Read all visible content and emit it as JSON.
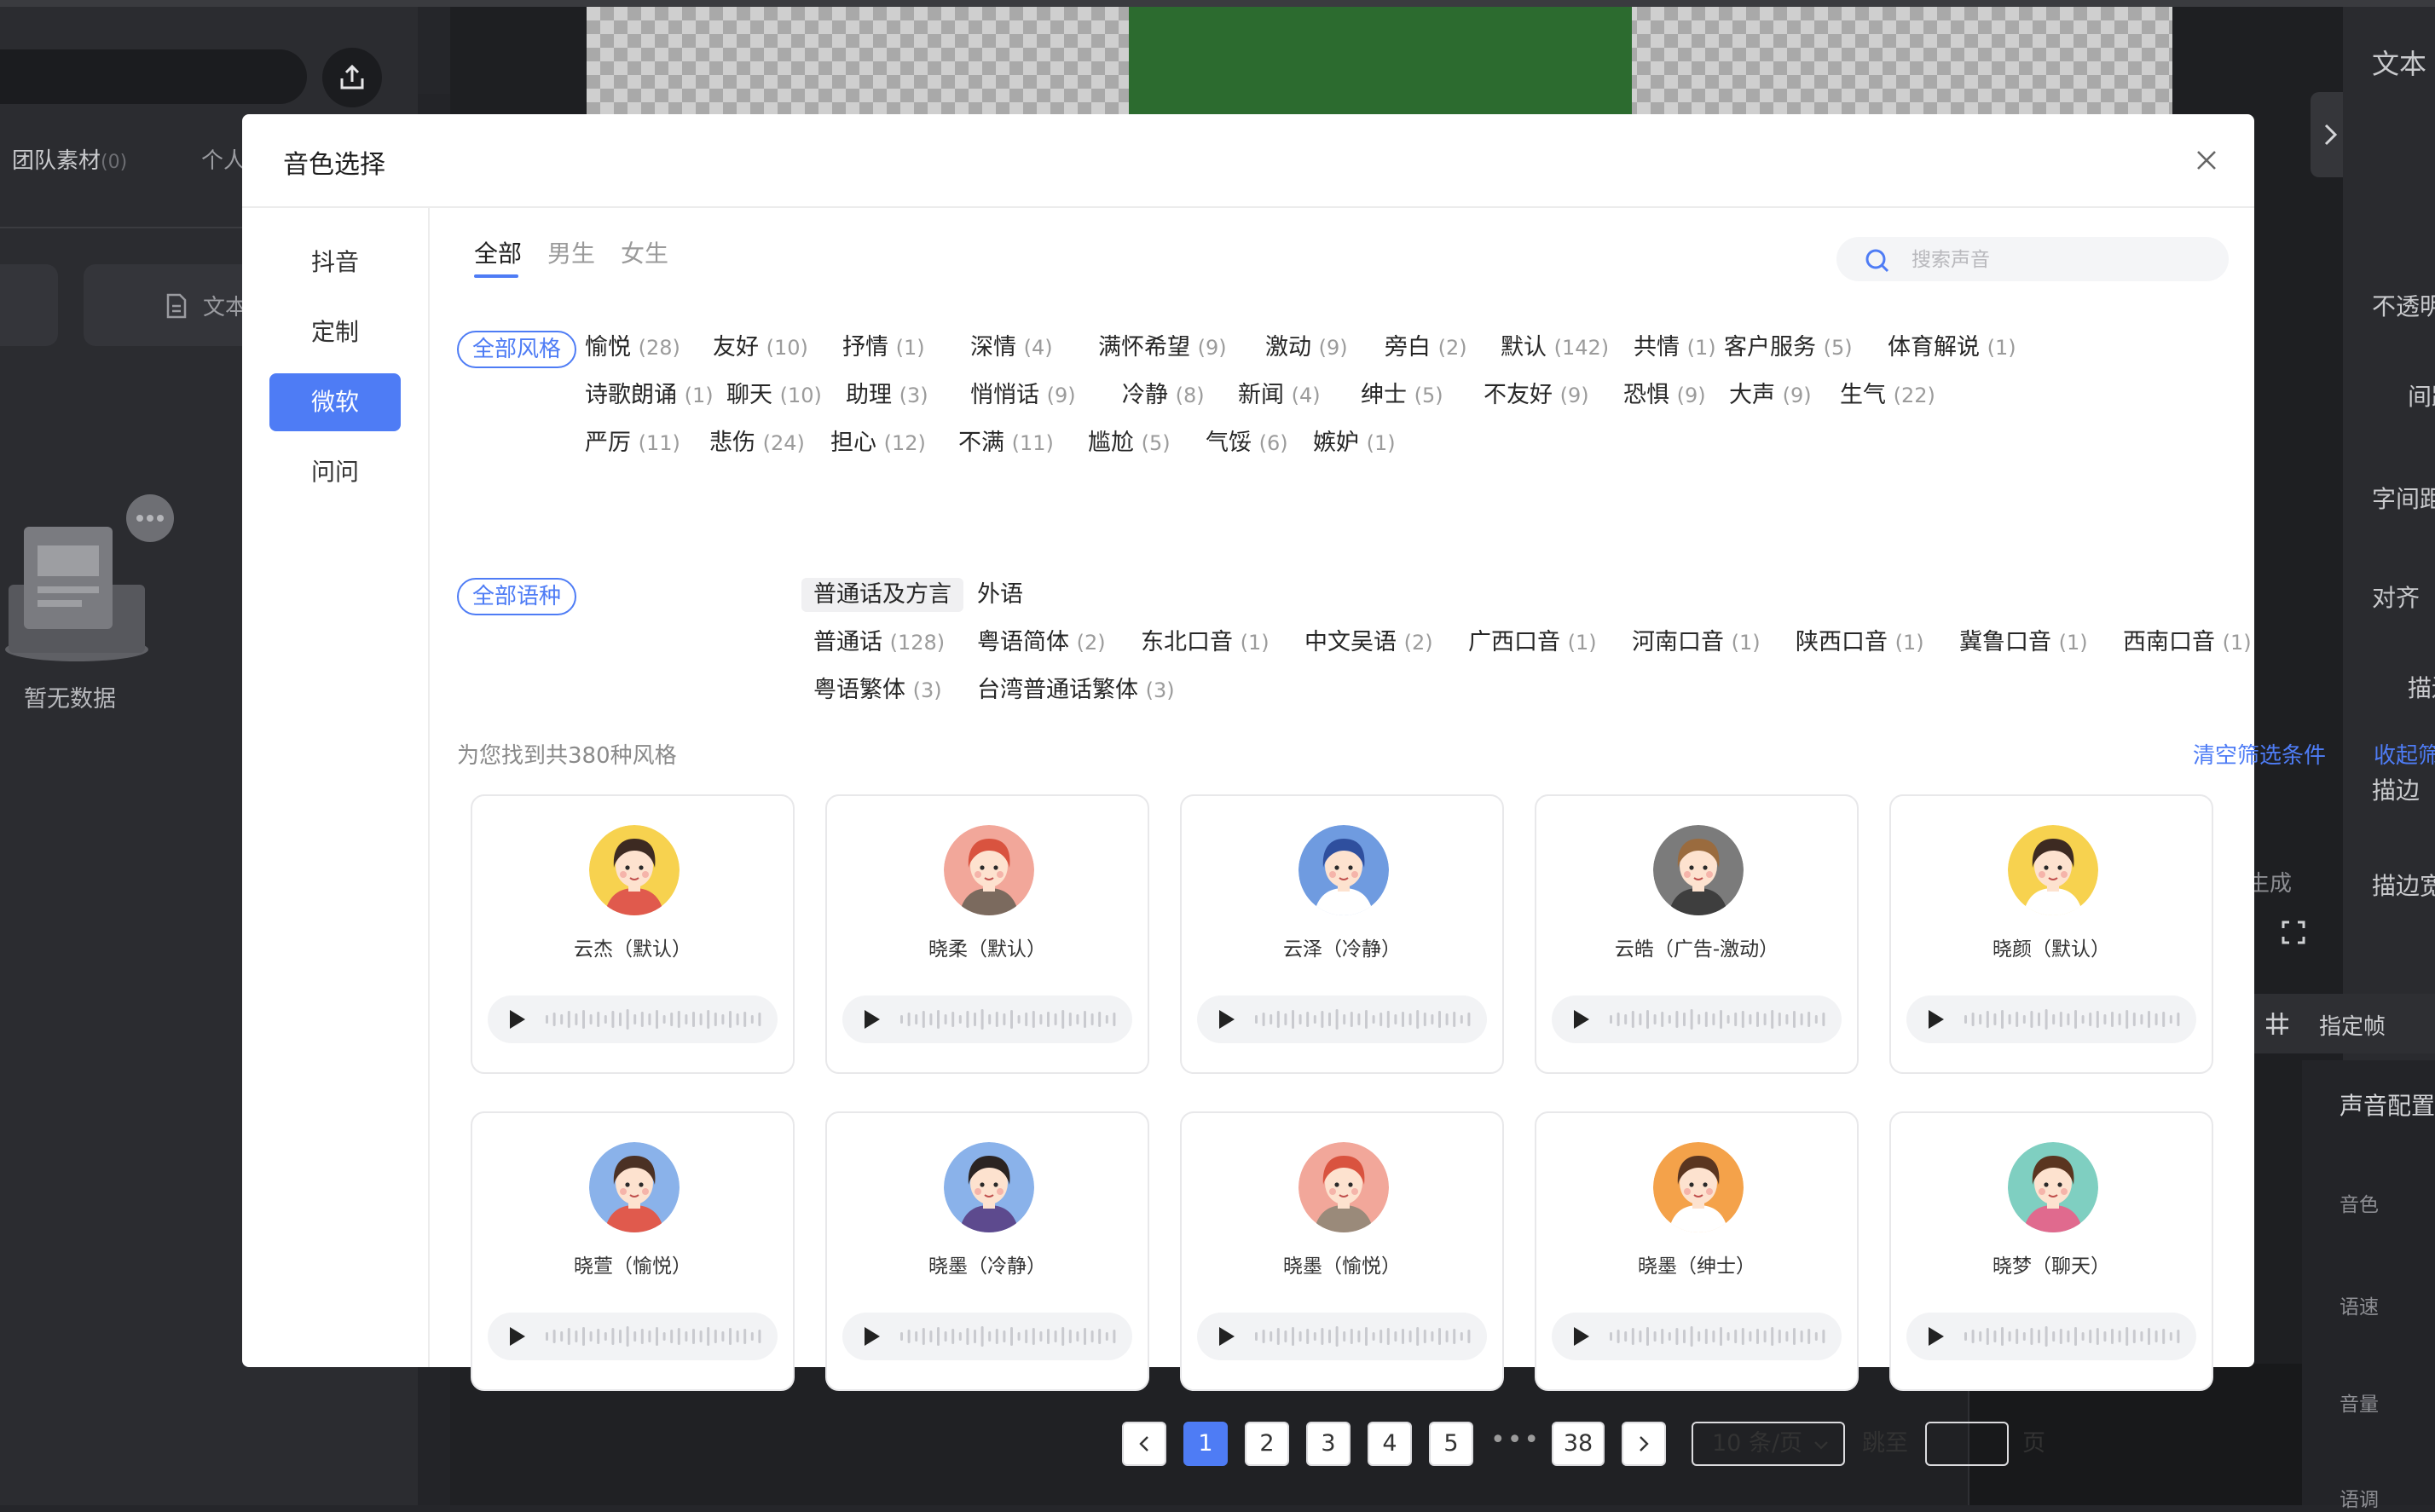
{
  "app": {
    "left_tabs": [
      "团队素材",
      "(0)",
      "个人"
    ],
    "left_chip_label": "文本",
    "empty_text": "暂无数据",
    "right_panel": [
      "文本",
      "不透明",
      "间距",
      "字间距",
      "对齐",
      "描边",
      "描边",
      "描边宽"
    ],
    "right_lower": [
      "声音配置",
      "音色",
      "语速",
      "音量",
      "语调"
    ],
    "side_hint": "生成",
    "frame_ctrl": "指定帧"
  },
  "modal": {
    "title": "音色选择",
    "sidebar": [
      "抖音",
      "定制",
      "微软",
      "问问"
    ],
    "sidebar_active": "微软",
    "gender_tabs": [
      "全部",
      "男生",
      "女生"
    ],
    "search_placeholder": "搜索声音",
    "style_filter_label": "全部风格",
    "styles": [
      {
        "name": "愉悦",
        "count": "(28)"
      },
      {
        "name": "友好",
        "count": "(10)"
      },
      {
        "name": "抒情",
        "count": "(1)"
      },
      {
        "name": "深情",
        "count": "(4)"
      },
      {
        "name": "满怀希望",
        "count": "(9)"
      },
      {
        "name": "激动",
        "count": "(9)"
      },
      {
        "name": "旁白",
        "count": "(2)"
      },
      {
        "name": "默认",
        "count": "(142)"
      },
      {
        "name": "共情",
        "count": "(1)"
      },
      {
        "name": "客户服务",
        "count": "(5)"
      },
      {
        "name": "体育解说",
        "count": "(1)"
      },
      {
        "name": "诗歌朗诵",
        "count": "(1)"
      },
      {
        "name": "聊天",
        "count": "(10)"
      },
      {
        "name": "助理",
        "count": "(3)"
      },
      {
        "name": "悄悄话",
        "count": "(9)"
      },
      {
        "name": "冷静",
        "count": "(8)"
      },
      {
        "name": "新闻",
        "count": "(4)"
      },
      {
        "name": "绅士",
        "count": "(5)"
      },
      {
        "name": "不友好",
        "count": "(9)"
      },
      {
        "name": "恐惧",
        "count": "(9)"
      },
      {
        "name": "大声",
        "count": "(9)"
      },
      {
        "name": "生气",
        "count": "(22)"
      },
      {
        "name": "严厉",
        "count": "(11)"
      },
      {
        "name": "悲伤",
        "count": "(24)"
      },
      {
        "name": "担心",
        "count": "(12)"
      },
      {
        "name": "不满",
        "count": "(11)"
      },
      {
        "name": "尴尬",
        "count": "(5)"
      },
      {
        "name": "气馁",
        "count": "(6)"
      },
      {
        "name": "嫉妒",
        "count": "(1)"
      }
    ],
    "language_filter_label": "全部语种",
    "language_groups": [
      "普通话及方言",
      "外语"
    ],
    "languages": [
      {
        "name": "普通话",
        "count": "(128)"
      },
      {
        "name": "粤语简体",
        "count": "(2)"
      },
      {
        "name": "东北口音",
        "count": "(1)"
      },
      {
        "name": "中文吴语",
        "count": "(2)"
      },
      {
        "name": "广西口音",
        "count": "(1)"
      },
      {
        "name": "河南口音",
        "count": "(1)"
      },
      {
        "name": "陕西口音",
        "count": "(1)"
      },
      {
        "name": "冀鲁口音",
        "count": "(1)"
      },
      {
        "name": "西南口音",
        "count": "(1)"
      },
      {
        "name": "粤语繁体",
        "count": "(3)"
      },
      {
        "name": "台湾普通话繁体",
        "count": "(3)"
      }
    ],
    "result_count": "为您找到共380种风格",
    "clear_filters": "清空筛选条件",
    "collapse_filters": "收起筛选",
    "voices": [
      {
        "name": "云杰（默认）",
        "avatar_bg": "#f7d24f",
        "hair": "#3d2a22",
        "skin": "#fde2cf",
        "shirt": "#e05a4d"
      },
      {
        "name": "晓柔（默认）",
        "avatar_bg": "#f2a79a",
        "hair": "#d9533f",
        "skin": "#fde2cf",
        "shirt": "#7b6a5e"
      },
      {
        "name": "云泽（冷静）",
        "avatar_bg": "#6f9be0",
        "hair": "#2f4f9e",
        "skin": "#fde2cf",
        "shirt": "#ffffff"
      },
      {
        "name": "云皓（广告-激动）",
        "avatar_bg": "#7b7b7b",
        "hair": "#9a6b3e",
        "skin": "#fde2cf",
        "shirt": "#3e3e3e"
      },
      {
        "name": "晓颜（默认）",
        "avatar_bg": "#f7d24f",
        "hair": "#3d2a22",
        "skin": "#fde2cf",
        "shirt": "#ffffff"
      },
      {
        "name": "晓萱（愉悦）",
        "avatar_bg": "#8ab2ea",
        "hair": "#4b3124",
        "skin": "#fde2cf",
        "shirt": "#e05a4d"
      },
      {
        "name": "晓墨（冷静）",
        "avatar_bg": "#8ab2ea",
        "hair": "#2b2422",
        "skin": "#fde2cf",
        "shirt": "#5d4a8e"
      },
      {
        "name": "晓墨（愉悦）",
        "avatar_bg": "#f2a79a",
        "hair": "#d9533f",
        "skin": "#fde2cf",
        "shirt": "#9a8a7a"
      },
      {
        "name": "晓墨（绅士）",
        "avatar_bg": "#f4a24a",
        "hair": "#5a3520",
        "skin": "#fde2cf",
        "shirt": "#ffffff"
      },
      {
        "name": "晓梦（聊天）",
        "avatar_bg": "#7fcfc1",
        "hair": "#5a3520",
        "skin": "#fde2cf",
        "shirt": "#e06a8e"
      }
    ],
    "pagination": {
      "pages": [
        "1",
        "2",
        "3",
        "4",
        "5"
      ],
      "ellipsis": "•••",
      "last_page": "38",
      "current": "1",
      "page_size": "10 条/页",
      "jump_label": "跳至",
      "page_suffix": "页"
    }
  }
}
